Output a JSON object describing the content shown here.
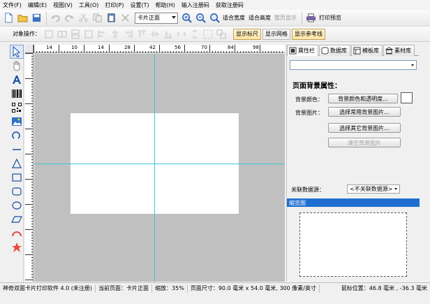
{
  "menu": [
    "文件(F)",
    "编辑(E)",
    "视图(V)",
    "工具(O)",
    "打印(P)",
    "设置(T)",
    "帮助(H)",
    "输入注册码",
    "获取注册码"
  ],
  "toolbar": {
    "page_combo": "卡片正面",
    "fit_width": "适合宽度",
    "fit_height": "适合高度",
    "full_page": "整页显示",
    "print_preview": "打印预览"
  },
  "object_toolbar": {
    "label": "对象操作：",
    "show_ruler": "显示标尺",
    "show_grid": "显示网格",
    "show_guides": "显示参考线"
  },
  "ruler_h_labels": [
    "14",
    "10",
    "14",
    "28",
    "42",
    "56",
    "70",
    "84",
    "98"
  ],
  "panel": {
    "tabs": [
      "属性栏",
      "数据库",
      "模板库",
      "素材库"
    ],
    "section_title": "页面背景属性：",
    "bg_color_label": "背景颜色：",
    "bg_color_button": "背景颜色和透明度...",
    "bg_image_label": "背景图片：",
    "choose_common_image": "选择常用背景图片...",
    "choose_other_image": "选择其它背景图片...",
    "clear_image": "清空背景图片",
    "assoc_label": "关联数据源：",
    "assoc_value": "<不关联数据源>",
    "thumbnail_title": "缩览图"
  },
  "status": {
    "app": "神奇双面卡片打印软件 4.0 (未注册)",
    "current_page": "当前页面：卡片正面",
    "zoom": "缩放：35%",
    "page_size": "页面尺寸：90.0 毫米 x 54.0 毫米, 300 像素/英寸",
    "mouse_pos": "鼠标位置：46.8 毫米 , -36.3 毫米"
  },
  "colors": {
    "guide": "#39c8d8",
    "canvas_bg": "#c0c0c0",
    "thumb_header": "#1f6fd0"
  }
}
